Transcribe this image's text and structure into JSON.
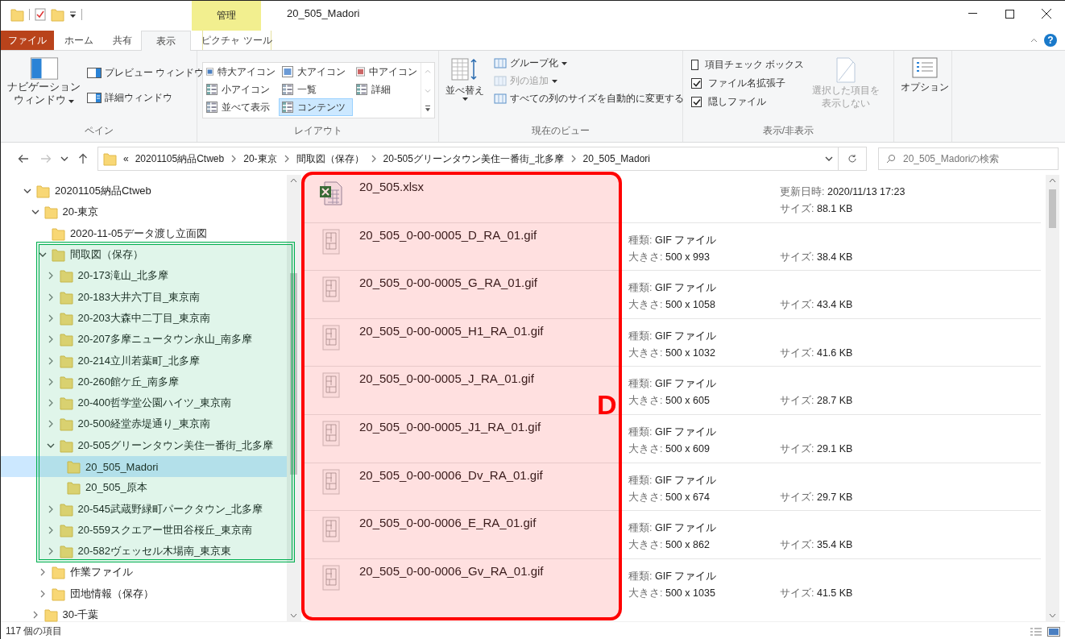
{
  "window": {
    "title": "20_505_Madori",
    "context_group": "管理",
    "help": "?"
  },
  "tabs": [
    {
      "label": "ファイル",
      "kind": "file",
      "selected": false
    },
    {
      "label": "ホーム",
      "kind": "normal",
      "selected": false
    },
    {
      "label": "共有",
      "kind": "normal",
      "selected": false
    },
    {
      "label": "表示",
      "kind": "normal",
      "selected": true
    },
    {
      "label": "ピクチャ ツール",
      "kind": "context",
      "selected": false
    }
  ],
  "ribbon": {
    "pane": {
      "label": "ペイン",
      "nav_pane": [
        "ナビゲーション",
        "ウィンドウ"
      ],
      "preview": "プレビュー ウィンドウ",
      "details": "詳細ウィンドウ"
    },
    "layout": {
      "label": "レイアウト",
      "options": [
        {
          "label": "特大アイコン",
          "selected": false
        },
        {
          "label": "大アイコン",
          "selected": false
        },
        {
          "label": "中アイコン",
          "selected": false
        },
        {
          "label": "小アイコン",
          "selected": false
        },
        {
          "label": "一覧",
          "selected": false
        },
        {
          "label": "詳細",
          "selected": false
        },
        {
          "label": "並べて表示",
          "selected": false
        },
        {
          "label": "コンテンツ",
          "selected": true
        }
      ]
    },
    "current_view": {
      "label": "現在のビュー",
      "sort": "並べ替え",
      "items": [
        {
          "label": "グループ化",
          "disabled": false,
          "dropdown": true
        },
        {
          "label": "列の追加",
          "disabled": true,
          "dropdown": true
        },
        {
          "label": "すべての列のサイズを自動的に変更する",
          "disabled": false,
          "dropdown": false
        }
      ]
    },
    "show_hide": {
      "label": "表示/非表示",
      "checks": [
        {
          "label": "項目チェック ボックス",
          "checked": false
        },
        {
          "label": "ファイル名拡張子",
          "checked": true
        },
        {
          "label": "隠しファイル",
          "checked": true
        }
      ],
      "hide_selected": {
        "lines": [
          "選択した項目を",
          "表示しない"
        ],
        "disabled": true
      }
    },
    "options": {
      "label": "オプション"
    }
  },
  "address": {
    "overflow": "«",
    "crumbs": [
      "20201105納品Ctweb",
      "20-東京",
      "間取図（保存）",
      "20-505グリーンタウン美住一番街_北多摩",
      "20_505_Madori"
    ],
    "search_placeholder": "20_505_Madoriの検索"
  },
  "tree": [
    {
      "label": "20201105納品Ctweb",
      "expandable": true,
      "expanded": true,
      "selected": false,
      "children": [
        {
          "label": "20-東京",
          "expandable": true,
          "expanded": true,
          "selected": false,
          "children": [
            {
              "label": "2020-11-05データ渡し立面図",
              "expandable": false,
              "selected": false
            },
            {
              "label": "間取図（保存）",
              "expandable": true,
              "expanded": true,
              "selected": false,
              "children": [
                {
                  "label": "20-173滝山_北多摩",
                  "expandable": true,
                  "expanded": false,
                  "selected": false
                },
                {
                  "label": "20-183大井六丁目_東京南",
                  "expandable": true,
                  "expanded": false,
                  "selected": false
                },
                {
                  "label": "20-203大森中二丁目_東京南",
                  "expandable": true,
                  "expanded": false,
                  "selected": false
                },
                {
                  "label": "20-207多摩ニュータウン永山_南多摩",
                  "expandable": true,
                  "expanded": false,
                  "selected": false
                },
                {
                  "label": "20-214立川若葉町_北多摩",
                  "expandable": true,
                  "expanded": false,
                  "selected": false
                },
                {
                  "label": "20-260館ケ丘_南多摩",
                  "expandable": true,
                  "expanded": false,
                  "selected": false
                },
                {
                  "label": "20-400哲学堂公園ハイツ_東京南",
                  "expandable": true,
                  "expanded": false,
                  "selected": false
                },
                {
                  "label": "20-500経堂赤堤通り_東京南",
                  "expandable": true,
                  "expanded": false,
                  "selected": false
                },
                {
                  "label": "20-505グリーンタウン美住一番街_北多摩",
                  "expandable": true,
                  "expanded": true,
                  "selected": false,
                  "children": [
                    {
                      "label": "20_505_Madori",
                      "expandable": false,
                      "selected": true
                    },
                    {
                      "label": "20_505_原本",
                      "expandable": false,
                      "selected": false
                    }
                  ]
                },
                {
                  "label": "20-545武蔵野緑町パークタウン_北多摩",
                  "expandable": true,
                  "expanded": false,
                  "selected": false
                },
                {
                  "label": "20-559スクエアー世田谷桜丘_東京南",
                  "expandable": true,
                  "expanded": false,
                  "selected": false
                },
                {
                  "label": "20-582ヴェッセル木場南_東京東",
                  "expandable": true,
                  "expanded": false,
                  "selected": false
                }
              ]
            },
            {
              "label": "作業ファイル",
              "expandable": true,
              "expanded": false,
              "selected": false
            },
            {
              "label": "団地情報（保存）",
              "expandable": true,
              "expanded": false,
              "selected": false
            }
          ]
        },
        {
          "label": "30-千葉",
          "expandable": true,
          "expanded": false,
          "selected": false
        }
      ]
    }
  ],
  "files": [
    {
      "name": "20_505.xlsx",
      "kind": "spreadsheet",
      "modified": {
        "label": "更新日時:",
        "value": "2020/11/13 17:23"
      },
      "size": {
        "label": "サイズ:",
        "value": "88.1 KB"
      }
    },
    {
      "name": "20_505_0-00-0005_D_RA_01.gif",
      "kind": "image",
      "type": {
        "label": "種類:",
        "value": "GIF ファイル"
      },
      "dimensions": {
        "label": "大きさ:",
        "value": "500 x 993"
      },
      "size": {
        "label": "サイズ:",
        "value": "38.4 KB"
      }
    },
    {
      "name": "20_505_0-00-0005_G_RA_01.gif",
      "kind": "image",
      "type": {
        "label": "種類:",
        "value": "GIF ファイル"
      },
      "dimensions": {
        "label": "大きさ:",
        "value": "500 x 1058"
      },
      "size": {
        "label": "サイズ:",
        "value": "43.4 KB"
      }
    },
    {
      "name": "20_505_0-00-0005_H1_RA_01.gif",
      "kind": "image",
      "type": {
        "label": "種類:",
        "value": "GIF ファイル"
      },
      "dimensions": {
        "label": "大きさ:",
        "value": "500 x 1032"
      },
      "size": {
        "label": "サイズ:",
        "value": "41.6 KB"
      }
    },
    {
      "name": "20_505_0-00-0005_J_RA_01.gif",
      "kind": "image",
      "type": {
        "label": "種類:",
        "value": "GIF ファイル"
      },
      "dimensions": {
        "label": "大きさ:",
        "value": "500 x 605"
      },
      "size": {
        "label": "サイズ:",
        "value": "28.7 KB"
      }
    },
    {
      "name": "20_505_0-00-0005_J1_RA_01.gif",
      "kind": "image",
      "type": {
        "label": "種類:",
        "value": "GIF ファイル"
      },
      "dimensions": {
        "label": "大きさ:",
        "value": "500 x 609"
      },
      "size": {
        "label": "サイズ:",
        "value": "29.1 KB"
      }
    },
    {
      "name": "20_505_0-00-0006_Dv_RA_01.gif",
      "kind": "image",
      "type": {
        "label": "種類:",
        "value": "GIF ファイル"
      },
      "dimensions": {
        "label": "大きさ:",
        "value": "500 x 674"
      },
      "size": {
        "label": "サイズ:",
        "value": "29.7 KB"
      }
    },
    {
      "name": "20_505_0-00-0006_E_RA_01.gif",
      "kind": "image",
      "type": {
        "label": "種類:",
        "value": "GIF ファイル"
      },
      "dimensions": {
        "label": "大きさ:",
        "value": "500 x 862"
      },
      "size": {
        "label": "サイズ:",
        "value": "35.4 KB"
      }
    },
    {
      "name": "20_505_0-00-0006_Gv_RA_01.gif",
      "kind": "image",
      "type": {
        "label": "種類:",
        "value": "GIF ファイル"
      },
      "dimensions": {
        "label": "大きさ:",
        "value": "500 x 1035"
      },
      "size": {
        "label": "サイズ:",
        "value": "41.5 KB"
      }
    }
  ],
  "status_bar": {
    "item_count": "117 個の項目"
  },
  "annotations": {
    "frames": [
      {
        "kind": "rounded",
        "color": "#ff0000"
      },
      {
        "kind": "double",
        "color": "#00b050"
      }
    ],
    "letter": {
      "text": "D",
      "color": "#ff0000"
    }
  }
}
